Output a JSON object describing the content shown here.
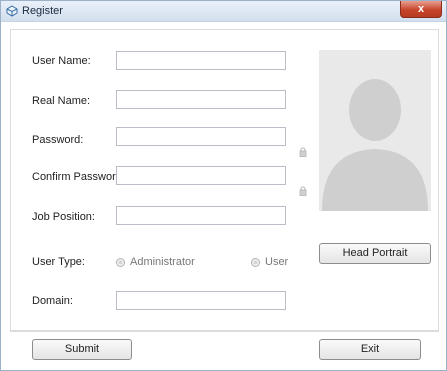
{
  "window": {
    "title": "Register",
    "close_glyph": "x"
  },
  "form": {
    "user_name_label": "User Name:",
    "real_name_label": "Real Name:",
    "password_label": "Password:",
    "confirm_password_label": "Confirm Password:",
    "job_position_label": "Job Position:",
    "user_type_label": "User Type:",
    "domain_label": "Domain:",
    "user_name_value": "",
    "real_name_value": "",
    "password_value": "",
    "confirm_password_value": "",
    "job_position_value": "",
    "domain_value": "",
    "user_type_options": [
      "Administrator",
      "User"
    ]
  },
  "buttons": {
    "head_portrait": "Head Portrait",
    "submit": "Submit",
    "exit": "Exit"
  },
  "icons": {
    "app": "register-icon",
    "lock": "lock-icon",
    "avatar": "avatar-placeholder-icon"
  }
}
